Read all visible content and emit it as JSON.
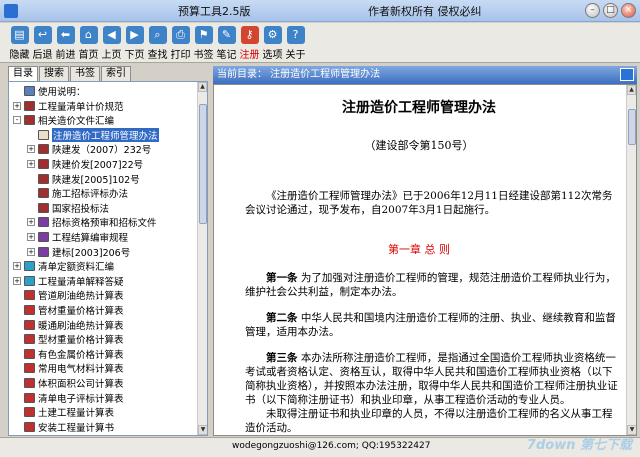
{
  "window": {
    "title": "预算工具2.5版",
    "author_notice": "作者新权所有  侵权必纠"
  },
  "toolbar": [
    {
      "label": "隐藏",
      "icon": "hide-icon"
    },
    {
      "label": "后退",
      "icon": "back-icon"
    },
    {
      "label": "前进",
      "icon": "forward-icon"
    },
    {
      "label": "首页",
      "icon": "home-icon"
    },
    {
      "label": "上页",
      "icon": "prev-page-icon"
    },
    {
      "label": "下页",
      "icon": "next-page-icon"
    },
    {
      "label": "查找",
      "icon": "search-icon"
    },
    {
      "label": "打印",
      "icon": "print-icon"
    },
    {
      "label": "书签",
      "icon": "bookmark-icon"
    },
    {
      "label": "笔记",
      "icon": "note-icon"
    },
    {
      "label": "注册",
      "icon": "register-icon",
      "accent": true
    },
    {
      "label": "选项",
      "icon": "options-icon"
    },
    {
      "label": "关于",
      "icon": "about-icon"
    }
  ],
  "tabs": [
    "目录",
    "搜索",
    "书签",
    "索引"
  ],
  "tree": [
    {
      "label": "使用说明：",
      "level": 0,
      "expander": "",
      "color": "#5a7fbf"
    },
    {
      "label": "工程量清单计价规范",
      "level": 0,
      "expander": "+",
      "color": "#a03030"
    },
    {
      "label": "相关造价文件汇编",
      "level": 0,
      "expander": "-",
      "color": "#a03030"
    },
    {
      "label": "注册造价工程师管理办法",
      "level": 1,
      "expander": "",
      "color": "#ffffff",
      "selected": true
    },
    {
      "label": "陕建发（2007）232号",
      "level": 1,
      "expander": "+",
      "color": "#a03030"
    },
    {
      "label": "陕建价发[2007]22号",
      "level": 1,
      "expander": "+",
      "color": "#a03030"
    },
    {
      "label": "陕建发[2005]102号",
      "level": 1,
      "expander": "",
      "color": "#a03030"
    },
    {
      "label": "施工招标评标办法",
      "level": 1,
      "expander": "",
      "color": "#a03030"
    },
    {
      "label": "国家招投标法",
      "level": 1,
      "expander": "",
      "color": "#a03030"
    },
    {
      "label": "招标资格预审和招标文件",
      "level": 1,
      "expander": "+",
      "color": "#7a3fa0"
    },
    {
      "label": "工程结算编审规程",
      "level": 1,
      "expander": "+",
      "color": "#7a3fa0"
    },
    {
      "label": "建标[2003]206号",
      "level": 1,
      "expander": "+",
      "color": "#7a3fa0"
    },
    {
      "label": "清单定额资料汇编",
      "level": 0,
      "expander": "+",
      "color": "#2e9fc7"
    },
    {
      "label": "工程量清单解释答疑",
      "level": 0,
      "expander": "+",
      "color": "#2e9fc7"
    },
    {
      "label": "管道刷油绝热计算表",
      "level": 0,
      "expander": "",
      "color": "#c03030"
    },
    {
      "label": "管材重量价格计算表",
      "level": 0,
      "expander": "",
      "color": "#c03030"
    },
    {
      "label": "暖通刷油绝热计算表",
      "level": 0,
      "expander": "",
      "color": "#c03030"
    },
    {
      "label": "型材重量价格计算表",
      "level": 0,
      "expander": "",
      "color": "#c03030"
    },
    {
      "label": "有色金属价格计算表",
      "level": 0,
      "expander": "",
      "color": "#c03030"
    },
    {
      "label": "常用电气材料计算表",
      "level": 0,
      "expander": "",
      "color": "#c03030"
    },
    {
      "label": "体积面积公司计算表",
      "level": 0,
      "expander": "",
      "color": "#c03030"
    },
    {
      "label": "清单电子评标计算表",
      "level": 0,
      "expander": "",
      "color": "#c03030"
    },
    {
      "label": "土建工程量计算表",
      "level": 0,
      "expander": "",
      "color": "#c03030"
    },
    {
      "label": "安装工程量计算书",
      "level": 0,
      "expander": "",
      "color": "#c03030"
    }
  ],
  "content": {
    "current_dir": "当前目录： 注册造价工程师管理办法",
    "title": "注册造价工程师管理办法",
    "subtitle": "（建设部令第150号）",
    "intro": "《注册造价工程师管理办法》已于2006年12月11日经建设部第112次常务会议讨论通过，现予发布，自2007年3月1日起施行。",
    "chapter": "第一章 总  则",
    "articles": [
      {
        "num": "第一条",
        "text": "为了加强对注册造价工程师的管理，规范注册造价工程师执业行为，维护社会公共利益，制定本办法。"
      },
      {
        "num": "第二条",
        "text": "中华人民共和国境内注册造价工程师的注册、执业、继续教育和监督管理，适用本办法。"
      },
      {
        "num": "第三条",
        "text": "本办法所称注册造价工程师，是指通过全国造价工程师执业资格统一考试或者资格认定、资格互认，取得中华人民共和国造价工程师执业资格（以下简称执业资格），并按照本办法注册，取得中华人民共和国造价工程师注册执业证书（以下简称注册证书）和执业印章，从事工程造价活动的专业人员。"
      }
    ],
    "last_para": "未取得注册证书和执业印章的人员，不得以注册造价工程师的名义从事工程造价活动。"
  },
  "status": {
    "text": "wodegongzuoshi@126.com; QQ:195322427"
  },
  "watermark": "7down 第七下载"
}
